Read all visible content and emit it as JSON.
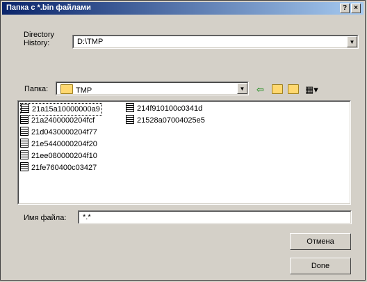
{
  "window": {
    "title": "Папка с *.bin файлами",
    "help_icon": "help-icon",
    "close_icon": "close-icon"
  },
  "directory_history": {
    "label_line1": "Directory",
    "label_line2": "History:",
    "value": "D:\\TMP"
  },
  "folder": {
    "label": "Папка:",
    "value": "TMP"
  },
  "toolbar": [
    "back-arrow-icon",
    "up-folder-icon",
    "new-folder-icon",
    "view-menu-icon"
  ],
  "files": {
    "col1": [
      "21a15a10000000a9",
      "21a2400000204fcf",
      "21d0430000204f77",
      "21e5440000204f20",
      "21ee080000204f10",
      "21fe760400c03427"
    ],
    "col2": [
      "214f910100c0341d",
      "21528a07004025e5"
    ]
  },
  "filename": {
    "label": "Имя файла:",
    "value": "*.*"
  },
  "buttons": {
    "cancel": "Отмена",
    "done": "Done"
  }
}
